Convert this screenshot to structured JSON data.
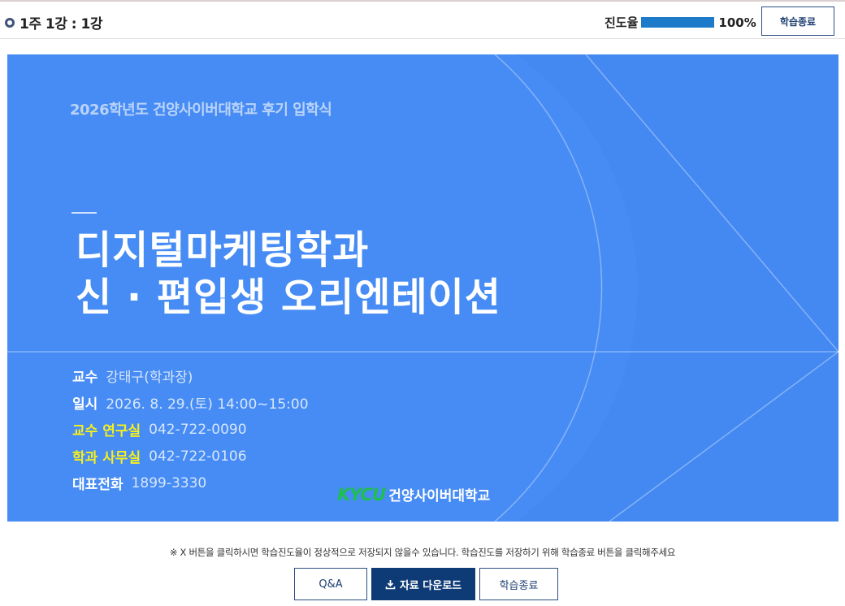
{
  "header": {
    "lesson_title": "1주 1강 : 1강",
    "progress_label": "진도율",
    "progress_value": "100%",
    "progress_fraction": 1.0,
    "end_button_label": "학습종료"
  },
  "slide": {
    "subtitle": "2026학년도 건양사이버대학교 후기 입학식",
    "title_line1": "디지털마케팅학과",
    "title_line2": "신 · 편입생 오리엔테이션",
    "info": [
      {
        "key": "교수",
        "value": "강태구(학과장)"
      },
      {
        "key": "일시",
        "value": "2026. 8. 29.(토) 14:00~15:00"
      },
      {
        "key": "교수 연구실",
        "value": "042-722-0090"
      },
      {
        "key": "학과 사무실",
        "value": "042-722-0106"
      },
      {
        "key": "대표전화",
        "value": "1899-3330"
      }
    ],
    "logo_mark": "KYCU",
    "logo_text": "건양사이버대학교"
  },
  "footer": {
    "notice": "※ X 버튼을 클릭하시면 학습진도율이 정상적으로 저장되지 않을수 있습니다. 학습진도를 저장하기 위해 학습종료 버튼을 클릭해주세요",
    "qa_label": "Q&A",
    "download_label": "자료 다운로드",
    "end_label": "학습종료"
  },
  "colors": {
    "slide_bg": "#4489f2",
    "progress_fill": "#1e7bc9",
    "primary_button": "#0e3b76",
    "highlight_yellow": "#f6f01a",
    "logo_green": "#1dbf4d"
  }
}
